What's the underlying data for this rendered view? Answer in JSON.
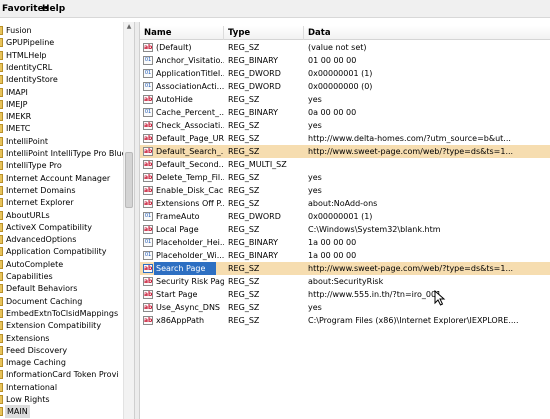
{
  "menu": {
    "favorites": "Favorites",
    "help": "Help"
  },
  "tree": {
    "items": [
      "Fusion",
      "GPUPipeline",
      "HTMLHelp",
      "IdentityCRL",
      "IdentityStore",
      "IMAPI",
      "IMEJP",
      "IMEKR",
      "IMETC",
      "IntelliPoint",
      "IntelliPoint IntelliType Pro Blueto",
      "IntelliType Pro",
      "Internet Account Manager",
      "Internet Domains",
      "Internet Explorer",
      "AboutURLs",
      "ActiveX Compatibility",
      "AdvancedOptions",
      "Application Compatibility",
      "AutoComplete",
      "Capabilities",
      "Default Behaviors",
      "Document Caching",
      "EmbedExtnToClsidMappings",
      "Extension Compatibility",
      "Extensions",
      "Feed Discovery",
      "Image Caching",
      "InformationCard Token Provi",
      "International",
      "Low Rights",
      "MAIN"
    ],
    "selected_index": 31
  },
  "columns": {
    "name": "Name",
    "type": "Type",
    "data": "Data"
  },
  "values": [
    {
      "name": "(Default)",
      "type": "REG_SZ",
      "data": "(value not set)",
      "icon": "string-value-icon"
    },
    {
      "name": "Anchor_Visitatio...",
      "type": "REG_BINARY",
      "data": "01 00 00 00",
      "icon": "binary-value-icon"
    },
    {
      "name": "ApplicationTitleI...",
      "type": "REG_DWORD",
      "data": "0x00000001 (1)",
      "icon": "binary-value-icon"
    },
    {
      "name": "AssociationActi...",
      "type": "REG_DWORD",
      "data": "0x00000000 (0)",
      "icon": "binary-value-icon"
    },
    {
      "name": "AutoHide",
      "type": "REG_SZ",
      "data": "yes",
      "icon": "string-value-icon"
    },
    {
      "name": "Cache_Percent_...",
      "type": "REG_BINARY",
      "data": "0a 00 00 00",
      "icon": "binary-value-icon"
    },
    {
      "name": "Check_Associati...",
      "type": "REG_SZ",
      "data": "yes",
      "icon": "string-value-icon"
    },
    {
      "name": "Default_Page_URL",
      "type": "REG_SZ",
      "data": "http://www.delta-homes.com/?utm_source=b&ut...",
      "icon": "string-value-icon"
    },
    {
      "name": "Default_Search_...",
      "type": "REG_SZ",
      "data": "http://www.sweet-page.com/web/?type=ds&ts=1...",
      "icon": "string-value-icon",
      "highlight": true
    },
    {
      "name": "Default_Second...",
      "type": "REG_MULTI_SZ",
      "data": "",
      "icon": "string-value-icon"
    },
    {
      "name": "Delete_Temp_Fil...",
      "type": "REG_SZ",
      "data": "yes",
      "icon": "string-value-icon"
    },
    {
      "name": "Enable_Disk_Cac...",
      "type": "REG_SZ",
      "data": "yes",
      "icon": "string-value-icon"
    },
    {
      "name": "Extensions Off P...",
      "type": "REG_SZ",
      "data": "about:NoAdd-ons",
      "icon": "string-value-icon"
    },
    {
      "name": "FrameAuto",
      "type": "REG_DWORD",
      "data": "0x00000001 (1)",
      "icon": "binary-value-icon"
    },
    {
      "name": "Local Page",
      "type": "REG_SZ",
      "data": "C:\\Windows\\System32\\blank.htm",
      "icon": "string-value-icon"
    },
    {
      "name": "Placeholder_Hei...",
      "type": "REG_BINARY",
      "data": "1a 00 00 00",
      "icon": "binary-value-icon"
    },
    {
      "name": "Placeholder_Wi...",
      "type": "REG_BINARY",
      "data": "1a 00 00 00",
      "icon": "binary-value-icon"
    },
    {
      "name": "Search Page",
      "type": "REG_SZ",
      "data": "http://www.sweet-page.com/web/?type=ds&ts=1...",
      "icon": "string-value-icon",
      "highlight": true,
      "selected": true
    },
    {
      "name": "Security Risk Page",
      "type": "REG_SZ",
      "data": "about:SecurityRisk",
      "icon": "string-value-icon"
    },
    {
      "name": "Start Page",
      "type": "REG_SZ",
      "data": "http://www.555.in.th/?tn=iro_001",
      "icon": "string-value-icon"
    },
    {
      "name": "Use_Async_DNS",
      "type": "REG_SZ",
      "data": "yes",
      "icon": "string-value-icon"
    },
    {
      "name": "x86AppPath",
      "type": "REG_SZ",
      "data": "C:\\Program Files (x86)\\Internet Explorer\\IEXPLORE....",
      "icon": "string-value-icon"
    }
  ]
}
